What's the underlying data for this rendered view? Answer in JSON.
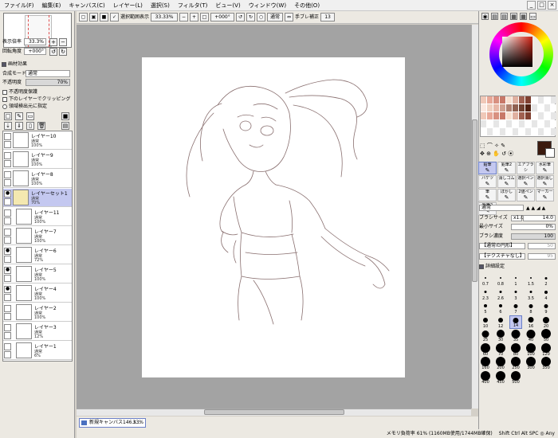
{
  "menu": [
    "ファイル(F)",
    "編集(E)",
    "キャンバス(C)",
    "レイヤー(L)",
    "選択(S)",
    "フィルタ(T)",
    "ビュー(V)",
    "ウィンドウ(W)",
    "その他(O)"
  ],
  "window_buttons": [
    "_",
    "□",
    "×"
  ],
  "navigator": {
    "zoom_label": "表示倍率",
    "zoom_value": "33.3%",
    "angle_label": "回転角度",
    "angle_value": "+000°"
  },
  "paper_texture": {
    "label": "画材効果"
  },
  "blend": {
    "mode_label": "合成モード",
    "mode_value": "通常",
    "opacity_label": "不透明度",
    "opacity_value": "70%"
  },
  "layer_options": {
    "preserve_opacity": "不透明度保護",
    "clip": "下のレイヤーでクリッピング",
    "pick_source": "領域検出元に指定"
  },
  "layers": [
    {
      "name": "レイヤー10",
      "mode": "通常",
      "opacity": "100%",
      "visible": false,
      "selected": false,
      "indent": false
    },
    {
      "name": "レイヤー9",
      "mode": "通常",
      "opacity": "100%",
      "visible": false,
      "selected": false,
      "indent": false
    },
    {
      "name": "レイヤー8",
      "mode": "通常",
      "opacity": "100%",
      "visible": false,
      "selected": false,
      "indent": false
    },
    {
      "name": "レイヤーセット1",
      "mode": "通常",
      "opacity": "70%",
      "visible": true,
      "selected": true,
      "indent": false
    },
    {
      "name": "レイヤー11",
      "mode": "通常",
      "opacity": "100%",
      "visible": false,
      "selected": false,
      "indent": true
    },
    {
      "name": "レイヤー7",
      "mode": "通常",
      "opacity": "100%",
      "visible": false,
      "selected": false,
      "indent": true
    },
    {
      "name": "レイヤー6",
      "mode": "通常",
      "opacity": "72%",
      "visible": true,
      "selected": false,
      "indent": true
    },
    {
      "name": "レイヤー5",
      "mode": "通常",
      "opacity": "100%",
      "visible": true,
      "selected": false,
      "indent": true
    },
    {
      "name": "レイヤー4",
      "mode": "通常",
      "opacity": "100%",
      "visible": true,
      "selected": false,
      "indent": true
    },
    {
      "name": "レイヤー2",
      "mode": "通常",
      "opacity": "100%",
      "visible": false,
      "selected": false,
      "indent": true
    },
    {
      "name": "レイヤー3",
      "mode": "通常",
      "opacity": "12%",
      "visible": false,
      "selected": false,
      "indent": true
    },
    {
      "name": "レイヤー1",
      "mode": "通常",
      "opacity": "6%",
      "visible": false,
      "selected": false,
      "indent": true
    }
  ],
  "toolbar": {
    "selection_display": "選択範囲表示",
    "zoom": "33.33%",
    "angle": "+000°",
    "mode": "通常",
    "stabilizer_label": "手ブレ補正",
    "stabilizer_value": "13"
  },
  "task": {
    "label": "新規キャンバス146.s...",
    "zoom": "33%"
  },
  "status": {
    "memory": "メモリ負荷率 61% (1160MB使用/1744MB確保)",
    "keys": "Shift Ctrl Alt SPC ◎ Any"
  },
  "tools": [
    {
      "name": "鉛筆",
      "icon": "pencil-icon"
    },
    {
      "name": "鉛筆2",
      "icon": "pencil-icon"
    },
    {
      "name": "エアブラシ",
      "icon": "airbrush-icon"
    },
    {
      "name": "水彩筆",
      "icon": "brush-icon"
    },
    {
      "name": "バケツ",
      "icon": "bucket-icon"
    },
    {
      "name": "消しゴム",
      "icon": "eraser-icon"
    },
    {
      "name": "選択ペン",
      "icon": "pen-icon"
    },
    {
      "name": "選択消し",
      "icon": "eraser-icon"
    },
    {
      "name": "筆",
      "icon": "brush-icon"
    },
    {
      "name": "ぼかし",
      "icon": "blur-icon"
    },
    {
      "name": "2値ペン",
      "icon": "pen-icon"
    },
    {
      "name": "マーカー",
      "icon": "marker-icon"
    },
    {
      "name": "鉛筆2",
      "icon": "pencil-icon"
    }
  ],
  "brush_settings": {
    "mode": "通常",
    "size_label": "ブラシサイズ",
    "size_multiplier": "x1.0",
    "size_value": "14.0",
    "min_label": "最小サイズ",
    "min_value": "0%",
    "density_label": "ブラシ濃度",
    "density_value": "100",
    "shape": "【通常の円形】",
    "texture": "【テクスチャなし】",
    "shape_strength": "50",
    "texture_strength": "95",
    "detail_label": "詳細設定"
  },
  "brush_sizes": [
    "0.7",
    "0.8",
    "1",
    "1.5",
    "2",
    "2.3",
    "2.6",
    "3",
    "3.5",
    "4",
    "5",
    "6",
    "7",
    "8",
    "9",
    "10",
    "12",
    "14",
    "16",
    "20",
    "25",
    "30",
    "35",
    "40",
    "50",
    "60",
    "70",
    "80",
    "100",
    "120",
    "160",
    "200",
    "250",
    "300",
    "350",
    "400",
    "450",
    "500"
  ],
  "colors": {
    "accent": "#6b80c8",
    "selection": "#c4c8f0",
    "primary": "#3b1a0e",
    "canvas_bg": "#a3a3a3"
  }
}
